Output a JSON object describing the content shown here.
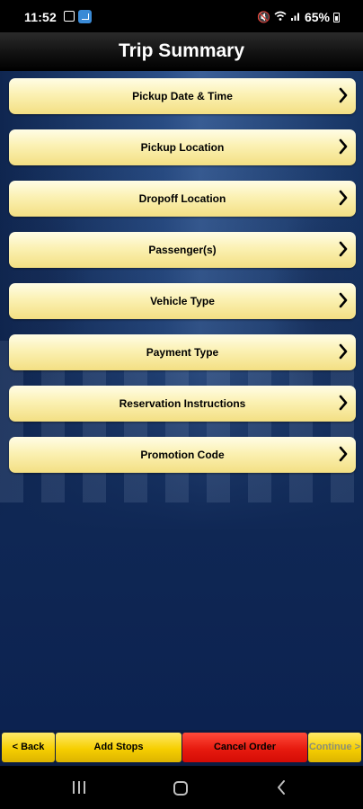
{
  "status_bar": {
    "time": "11:52",
    "battery": "65%",
    "icons": [
      "image-icon",
      "app-notification-icon",
      "mute-icon",
      "wifi-icon",
      "signal-icon",
      "battery-icon"
    ]
  },
  "header": {
    "title": "Trip Summary"
  },
  "menu": {
    "items": [
      {
        "label": "Pickup Date & Time"
      },
      {
        "label": "Pickup Location"
      },
      {
        "label": "Dropoff Location"
      },
      {
        "label": "Passenger(s)"
      },
      {
        "label": "Vehicle Type"
      },
      {
        "label": "Payment Type"
      },
      {
        "label": "Reservation Instructions"
      },
      {
        "label": "Promotion Code"
      }
    ]
  },
  "bottom_bar": {
    "back_label": "< Back",
    "add_stops_label": "Add Stops",
    "cancel_label": "Cancel Order",
    "continue_label": "Continue >"
  },
  "colors": {
    "accent_yellow": "#F6CF00",
    "cancel_red": "#E71B0F",
    "menu_item_bg": "#FBF1B3",
    "background_blue": "#0F2754"
  },
  "nav_bar": {
    "icons": [
      "recents-icon",
      "home-icon",
      "back-icon"
    ]
  }
}
